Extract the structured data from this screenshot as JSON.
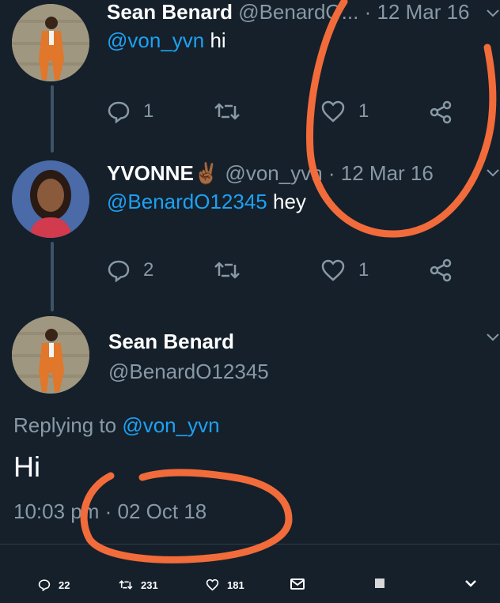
{
  "tweets": [
    {
      "name": "Sean Benard",
      "handle": "@BenardO...",
      "date": "· 12 Mar 16",
      "mention": "@von_yvn",
      "text": " hi",
      "reply_count": "1",
      "like_count": "1"
    },
    {
      "name": "YVONNE✌🏾",
      "handle": "@von_yvn",
      "date": "· 12 Mar 16",
      "mention": "@BenardO12345",
      "text": " hey",
      "reply_count": "2",
      "like_count": "1"
    }
  ],
  "main_tweet": {
    "name": "Sean Benard",
    "handle": "@BenardO12345",
    "replying_prefix": "Replying to ",
    "replying_to": "@von_yvn",
    "text": "Hi",
    "timestamp": "10:03 pm · 02 Oct 18"
  },
  "bottom_bar": {
    "replies": "22",
    "retweets": "231",
    "likes": "181"
  },
  "colors": {
    "background": "#15202b",
    "link": "#1da1f2",
    "muted": "#8899a6",
    "annotation": "#f26b3a"
  }
}
